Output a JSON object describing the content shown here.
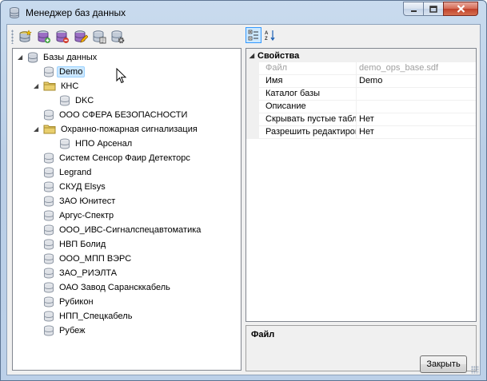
{
  "window": {
    "title": "Менеджер баз данных"
  },
  "toolbar": {
    "buttons": [
      {
        "icon": "new-database-icon"
      },
      {
        "icon": "add-database-icon"
      },
      {
        "icon": "delete-database-icon"
      },
      {
        "icon": "edit-database-icon"
      },
      {
        "icon": "database-properties-icon"
      },
      {
        "icon": "database-settings-icon"
      }
    ]
  },
  "tree": {
    "root": "Базы данных",
    "items": [
      {
        "label": "Demo",
        "type": "db",
        "selected": true
      },
      {
        "label": "КНС",
        "type": "folder",
        "expanded": true
      },
      {
        "label": "DKC",
        "type": "db"
      },
      {
        "label": "ООО СФЕРА БЕЗОПАСНОСТИ",
        "type": "db"
      },
      {
        "label": "Охранно-пожарная сигнализация",
        "type": "folder",
        "expanded": true
      },
      {
        "label": "НПО Арсенал",
        "type": "db"
      },
      {
        "label": "Систем Сенсор Фаир Детекторс",
        "type": "db"
      },
      {
        "label": "Legrand",
        "type": "db"
      },
      {
        "label": "СКУД Elsys",
        "type": "db"
      },
      {
        "label": "ЗАО Юнитест",
        "type": "db"
      },
      {
        "label": "Аргус-Спектр",
        "type": "db"
      },
      {
        "label": "ООО_ИВС-Сигналспецавтоматика",
        "type": "db"
      },
      {
        "label": "НВП Болид",
        "type": "db"
      },
      {
        "label": "ООО_МПП ВЭРС",
        "type": "db"
      },
      {
        "label": "ЗАО_РИЭЛТА",
        "type": "db"
      },
      {
        "label": "ОАО Завод Сарансккабель",
        "type": "db"
      },
      {
        "label": "Рубикон",
        "type": "db"
      },
      {
        "label": "НПП_Спецкабель",
        "type": "db"
      },
      {
        "label": "Рубеж",
        "type": "db"
      }
    ]
  },
  "propgrid": {
    "category": "Свойства",
    "rows": [
      {
        "name": "Файл",
        "value": "demo_ops_base.sdf",
        "readonly": true
      },
      {
        "name": "Имя",
        "value": "Demo"
      },
      {
        "name": "Каталог базы",
        "value": ""
      },
      {
        "name": "Описание",
        "value": ""
      },
      {
        "name": "Скрывать пустые табл",
        "value": "Нет"
      },
      {
        "name": "Разрешить редактиров",
        "value": "Нет"
      }
    ],
    "help_title": "Файл"
  },
  "buttons": {
    "close": "Закрыть"
  },
  "colors": {
    "selection": "#cce8ff",
    "titlebar": "#c9dbee",
    "close_button": "#c0412a"
  }
}
